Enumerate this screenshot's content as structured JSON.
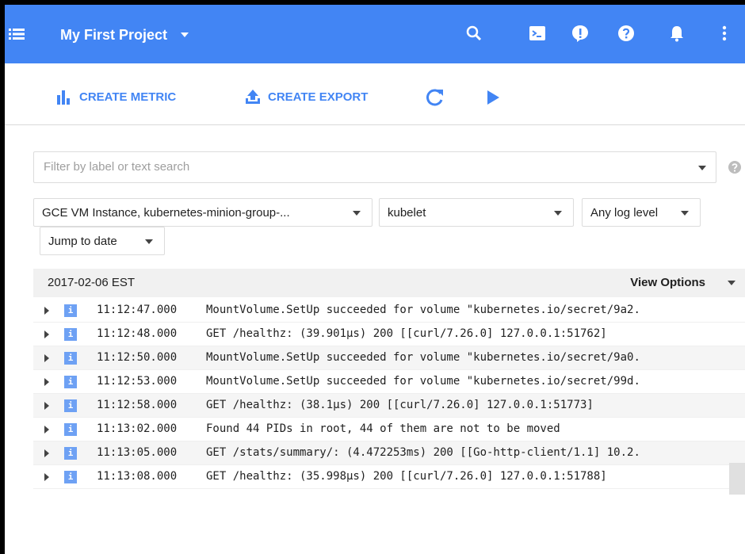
{
  "header": {
    "project_name": "My First Project",
    "icons": [
      "menu-icon",
      "search-icon",
      "cloud-shell-icon",
      "alert-icon",
      "help-icon",
      "notifications-icon",
      "more-vert-icon"
    ],
    "brand_color": "#4285f4"
  },
  "toolbar": {
    "create_metric_label": "CREATE METRIC",
    "create_export_label": "CREATE EXPORT",
    "icons": [
      "refresh-icon",
      "play-icon"
    ]
  },
  "filter": {
    "placeholder": "Filter by label or text search",
    "value": ""
  },
  "dropdowns": {
    "resource": "GCE VM Instance, kubernetes-minion-group-...",
    "log_name": "kubelet",
    "log_level": "Any log level",
    "jump_to_date": "Jump to date"
  },
  "log_header": {
    "date": "2017-02-06 EST",
    "view_options": "View Options"
  },
  "logs": [
    {
      "severity": "i",
      "time": "11:12:47.000",
      "message": "MountVolume.SetUp succeeded for volume \"kubernetes.io/secret/9a2."
    },
    {
      "severity": "i",
      "time": "11:12:48.000",
      "message": "GET /healthz: (39.901µs) 200 [[curl/7.26.0] 127.0.0.1:51762]"
    },
    {
      "severity": "i",
      "time": "11:12:50.000",
      "message": "MountVolume.SetUp succeeded for volume \"kubernetes.io/secret/9a0."
    },
    {
      "severity": "i",
      "time": "11:12:53.000",
      "message": "MountVolume.SetUp succeeded for volume \"kubernetes.io/secret/99d."
    },
    {
      "severity": "i",
      "time": "11:12:58.000",
      "message": "GET /healthz: (38.1µs) 200 [[curl/7.26.0] 127.0.0.1:51773]"
    },
    {
      "severity": "i",
      "time": "11:13:02.000",
      "message": "Found 44 PIDs in root, 44 of them are not to be moved"
    },
    {
      "severity": "i",
      "time": "11:13:05.000",
      "message": "GET /stats/summary/: (4.472253ms) 200 [[Go-http-client/1.1] 10.2."
    },
    {
      "severity": "i",
      "time": "11:13:08.000",
      "message": "GET /healthz: (35.998µs) 200 [[curl/7.26.0] 127.0.0.1:51788]"
    }
  ]
}
